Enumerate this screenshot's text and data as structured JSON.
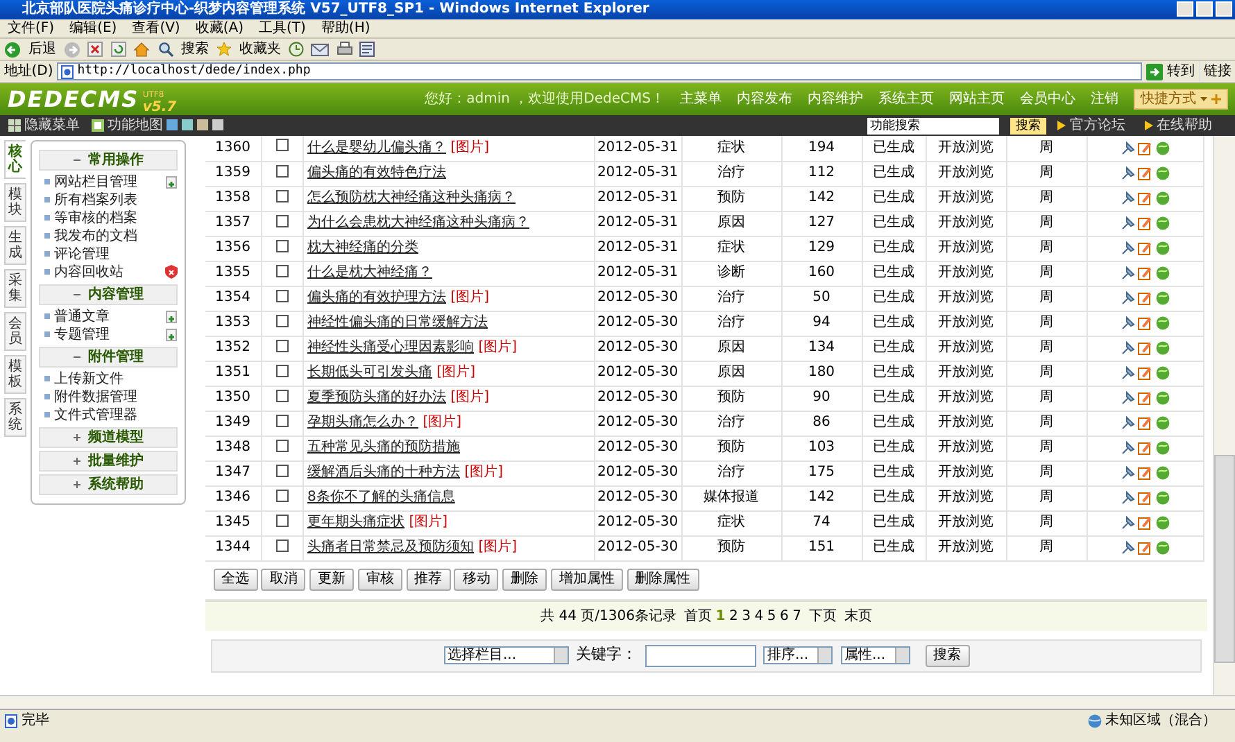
{
  "window": {
    "title": "北京部队医院头痛诊疗中心-织梦内容管理系统 V57_UTF8_SP1 - Windows Internet Explorer"
  },
  "menu": [
    "文件(F)",
    "编辑(E)",
    "查看(V)",
    "收藏(A)",
    "工具(T)",
    "帮助(H)"
  ],
  "toolbar": {
    "back": "后退",
    "search": "搜索",
    "favorites": "收藏夹"
  },
  "address_bar": {
    "label": "地址(D)",
    "url": "http://localhost/dede/index.php",
    "go": "转到",
    "links": "链接"
  },
  "header": {
    "logo": "DEDECMS",
    "version": "v5.7",
    "edition": "UTF8",
    "welcome": "您好：admin ，欢迎使用DedeCMS！",
    "nav": [
      "主菜单",
      "内容发布",
      "内容维护",
      "系统主页",
      "网站主页",
      "会员中心",
      "注销"
    ],
    "shortcut": "快捷方式"
  },
  "subheader": {
    "hide_menu": "隐藏菜单",
    "function_map": "功能地图",
    "search_value": "功能搜索",
    "search_button": "搜索",
    "forum": "官方论坛",
    "help": "在线帮助"
  },
  "side_tabs": [
    {
      "label": "核心",
      "selected": true
    },
    {
      "label": "模块",
      "selected": false
    },
    {
      "label": "生成",
      "selected": false
    },
    {
      "label": "采集",
      "selected": false
    },
    {
      "label": "会员",
      "selected": false
    },
    {
      "label": "模板",
      "selected": false
    },
    {
      "label": "系统",
      "selected": false
    }
  ],
  "sidebar": [
    {
      "title": "常用操作",
      "expanded": true,
      "items": [
        {
          "label": "网站栏目管理",
          "kind": "add"
        },
        {
          "label": "所有档案列表",
          "kind": "link"
        },
        {
          "label": "等审核的档案",
          "kind": "link"
        },
        {
          "label": "我发布的文档",
          "kind": "link"
        },
        {
          "label": "评论管理",
          "kind": "link"
        },
        {
          "label": "内容回收站",
          "kind": "trash"
        }
      ]
    },
    {
      "title": "内容管理",
      "expanded": true,
      "items": [
        {
          "label": "普通文章",
          "kind": "add"
        },
        {
          "label": "专题管理",
          "kind": "add"
        }
      ]
    },
    {
      "title": "附件管理",
      "expanded": true,
      "items": [
        {
          "label": "上传新文件",
          "kind": "link"
        },
        {
          "label": "附件数据管理",
          "kind": "link"
        },
        {
          "label": "文件式管理器",
          "kind": "link"
        }
      ]
    },
    {
      "title": "频道模型",
      "expanded": false
    },
    {
      "title": "批量维护",
      "expanded": false
    },
    {
      "title": "系统帮助",
      "expanded": false
    }
  ],
  "table": {
    "rows": [
      {
        "id": "1360",
        "checked": false,
        "title": "什么是婴幼儿偏头痛？",
        "tag": "[图片]",
        "date": "2012-05-31",
        "category": "症状",
        "clicks": "194",
        "status": "已生成",
        "access": "开放浏览",
        "publisher": "周"
      },
      {
        "id": "1359",
        "checked": false,
        "title": "偏头痛的有效特色疗法",
        "date": "2012-05-31",
        "category": "治疗",
        "clicks": "112",
        "status": "已生成",
        "access": "开放浏览",
        "publisher": "周"
      },
      {
        "id": "1358",
        "checked": false,
        "title": "怎么预防枕大神经痛这种头痛病？",
        "date": "2012-05-31",
        "category": "预防",
        "clicks": "142",
        "status": "已生成",
        "access": "开放浏览",
        "publisher": "周"
      },
      {
        "id": "1357",
        "checked": false,
        "title": "为什么会患枕大神经痛这种头痛病？",
        "date": "2012-05-31",
        "category": "原因",
        "clicks": "127",
        "status": "已生成",
        "access": "开放浏览",
        "publisher": "周"
      },
      {
        "id": "1356",
        "checked": false,
        "title": "枕大神经痛的分类",
        "date": "2012-05-31",
        "category": "症状",
        "clicks": "129",
        "status": "已生成",
        "access": "开放浏览",
        "publisher": "周"
      },
      {
        "id": "1355",
        "checked": false,
        "title": "什么是枕大神经痛？",
        "date": "2012-05-31",
        "category": "诊断",
        "clicks": "160",
        "status": "已生成",
        "access": "开放浏览",
        "publisher": "周"
      },
      {
        "id": "1354",
        "checked": false,
        "title": "偏头痛的有效护理方法",
        "tag": "[图片]",
        "date": "2012-05-30",
        "category": "治疗",
        "clicks": "50",
        "status": "已生成",
        "access": "开放浏览",
        "publisher": "周"
      },
      {
        "id": "1353",
        "checked": false,
        "title": "神经性偏头痛的日常缓解方法",
        "date": "2012-05-30",
        "category": "治疗",
        "clicks": "94",
        "status": "已生成",
        "access": "开放浏览",
        "publisher": "周"
      },
      {
        "id": "1352",
        "checked": false,
        "title": "神经性头痛受心理因素影响",
        "tag": "[图片]",
        "date": "2012-05-30",
        "category": "原因",
        "clicks": "134",
        "status": "已生成",
        "access": "开放浏览",
        "publisher": "周"
      },
      {
        "id": "1351",
        "checked": false,
        "title": "长期低头可引发头痛",
        "tag": "[图片]",
        "date": "2012-05-30",
        "category": "原因",
        "clicks": "180",
        "status": "已生成",
        "access": "开放浏览",
        "publisher": "周"
      },
      {
        "id": "1350",
        "checked": false,
        "title": "夏季预防头痛的好办法",
        "tag": "[图片]",
        "date": "2012-05-30",
        "category": "预防",
        "clicks": "90",
        "status": "已生成",
        "access": "开放浏览",
        "publisher": "周"
      },
      {
        "id": "1349",
        "checked": false,
        "title": "孕期头痛怎么办？",
        "tag": "[图片]",
        "date": "2012-05-30",
        "category": "治疗",
        "clicks": "86",
        "status": "已生成",
        "access": "开放浏览",
        "publisher": "周"
      },
      {
        "id": "1348",
        "checked": false,
        "title": "五种常见头痛的预防措施",
        "date": "2012-05-30",
        "category": "预防",
        "clicks": "103",
        "status": "已生成",
        "access": "开放浏览",
        "publisher": "周"
      },
      {
        "id": "1347",
        "checked": false,
        "title": "缓解酒后头痛的十种方法",
        "tag": "[图片]",
        "date": "2012-05-30",
        "category": "治疗",
        "clicks": "175",
        "status": "已生成",
        "access": "开放浏览",
        "publisher": "周"
      },
      {
        "id": "1346",
        "checked": false,
        "title": "8条你不了解的头痛信息",
        "date": "2012-05-30",
        "category": "媒体报道",
        "clicks": "142",
        "status": "已生成",
        "access": "开放浏览",
        "publisher": "周"
      },
      {
        "id": "1345",
        "checked": false,
        "title": "更年期头痛症状",
        "tag": "[图片]",
        "date": "2012-05-30",
        "category": "症状",
        "clicks": "74",
        "status": "已生成",
        "access": "开放浏览",
        "publisher": "周"
      },
      {
        "id": "1344",
        "checked": false,
        "title": "头痛者日常禁忌及预防须知",
        "tag": "[图片]",
        "date": "2012-05-30",
        "category": "预防",
        "clicks": "151",
        "status": "已生成",
        "access": "开放浏览",
        "publisher": "周"
      }
    ]
  },
  "batch_buttons": [
    "全选",
    "取消",
    "更新",
    "审核",
    "推荐",
    "移动",
    "删除",
    "增加属性",
    "删除属性"
  ],
  "pagination": {
    "summary": "共 44 页/1306条记录",
    "first": "首页",
    "pages": [
      {
        "label": "1",
        "selected": true
      },
      {
        "label": "2",
        "selected": false
      },
      {
        "label": "3",
        "selected": false
      },
      {
        "label": "4",
        "selected": false
      },
      {
        "label": "5",
        "selected": false
      },
      {
        "label": "6",
        "selected": false
      },
      {
        "label": "7",
        "selected": false
      }
    ],
    "next": "下页",
    "last": "末页"
  },
  "search": {
    "column_select": "选择栏目...",
    "keyword_label": "关键字：",
    "order_select": "排序...",
    "attribute_select": "属性...",
    "button": "搜索"
  },
  "status_bar": {
    "text": "完毕",
    "zone": "未知区域（混合）"
  }
}
